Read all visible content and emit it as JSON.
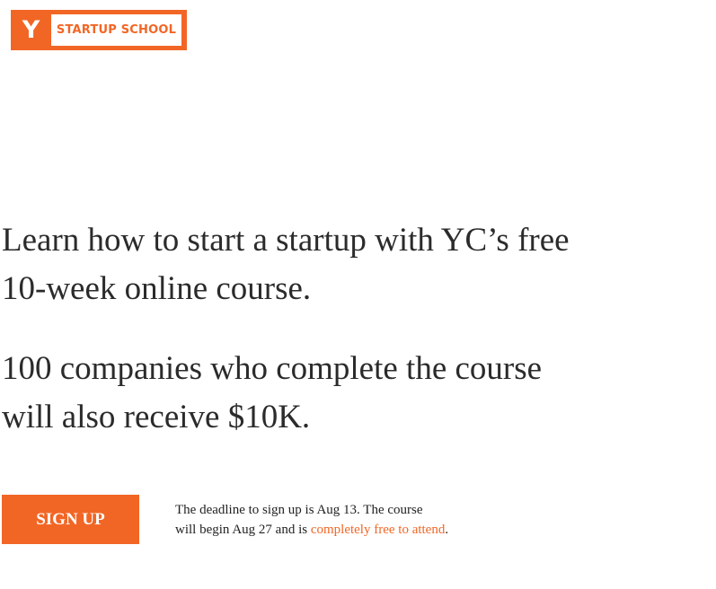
{
  "logo": {
    "letter": "Y",
    "text": "STARTUP SCHOOL"
  },
  "hero": {
    "line1": "Learn how to start a startup with YC’s free",
    "line2": "10-week online course.",
    "line3": "100 companies who complete the course",
    "line4": "will also receive $10K."
  },
  "cta": {
    "button_label": "SIGN UP",
    "note_line1": "The deadline to sign up is Aug 13. The course",
    "note_line2_prefix": "will begin Aug 27 and is ",
    "note_link": "completely free to attend",
    "note_suffix": "."
  },
  "colors": {
    "brand_orange": "#f26625",
    "text_dark": "#2b2b2b",
    "background": "#ffffff"
  }
}
